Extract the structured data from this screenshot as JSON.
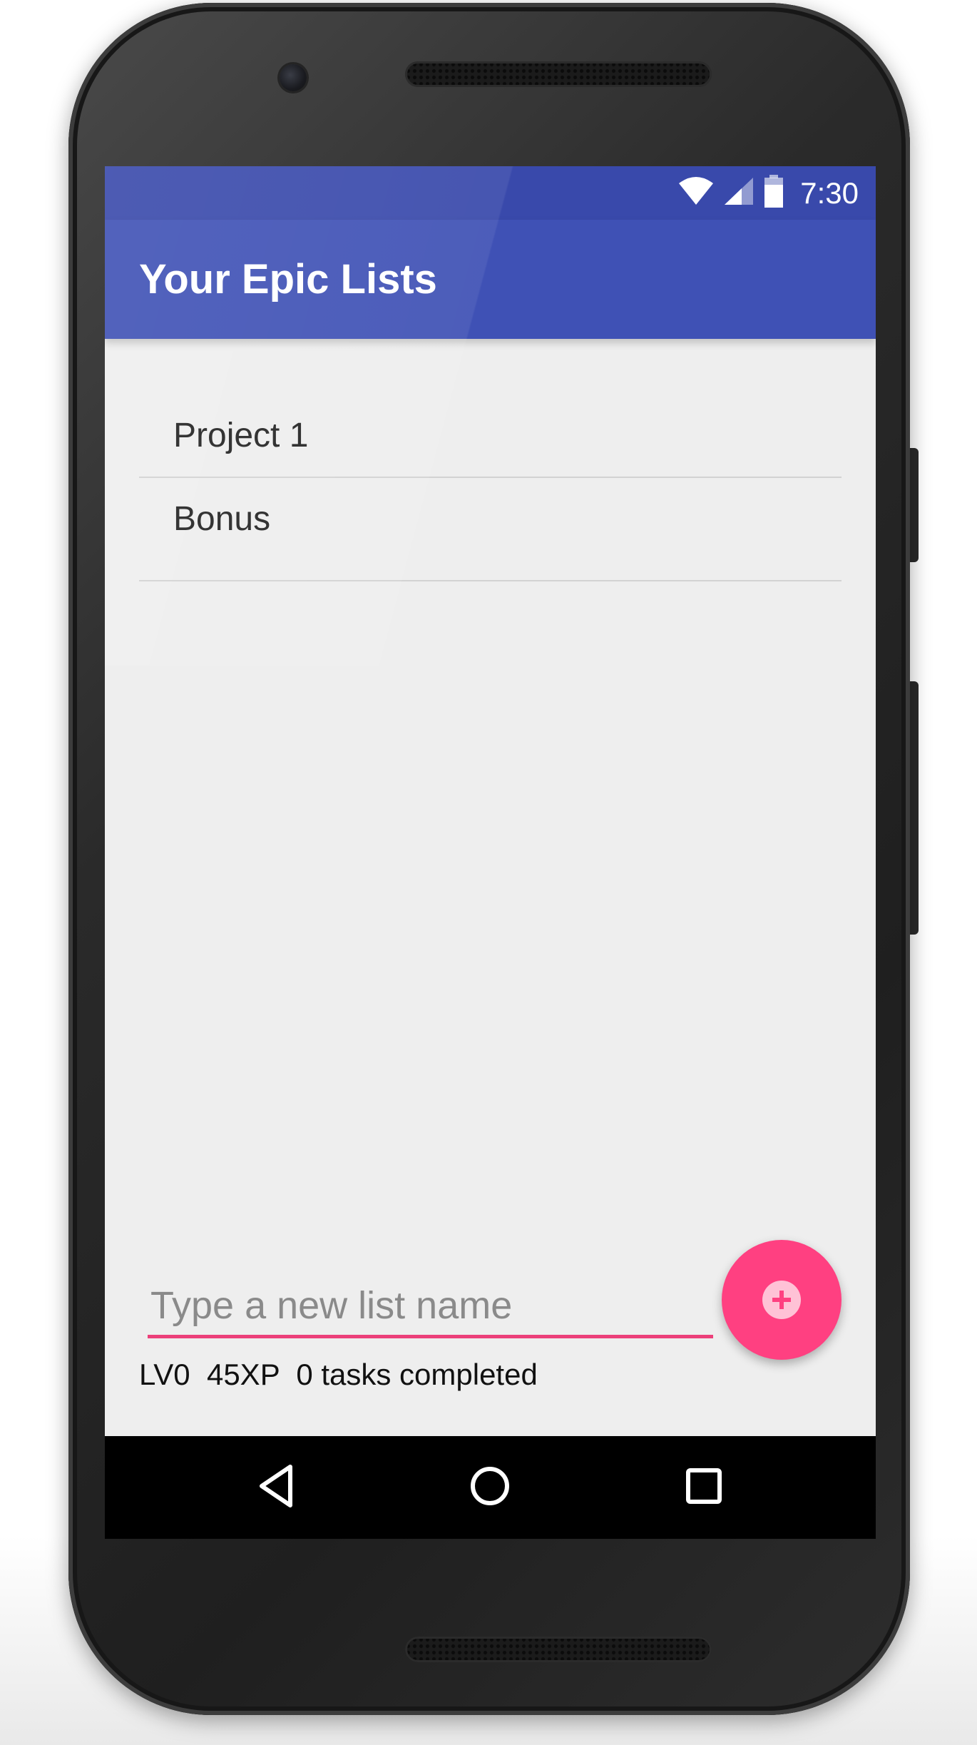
{
  "status_bar": {
    "time": "7:30",
    "icons": [
      "wifi-icon",
      "cell-signal-icon",
      "battery-icon"
    ]
  },
  "app_bar": {
    "title": "Your Epic Lists"
  },
  "lists": {
    "items": [
      {
        "label": "Project 1"
      },
      {
        "label": "Bonus"
      }
    ]
  },
  "new_list": {
    "value": "",
    "placeholder": "Type a new list name",
    "add_icon": "plus-circle-icon"
  },
  "stats": {
    "level": "LV0",
    "xp": "45XP",
    "tasks": "0 tasks completed"
  },
  "nav": {
    "icons": [
      "back-icon",
      "home-icon",
      "recents-icon"
    ]
  },
  "colors": {
    "status_bar": "#3949ab",
    "app_bar": "#3f51b5",
    "accent": "#ff4081",
    "input_underline": "#ec407a",
    "background": "#eeeeee",
    "nav_bar": "#000000"
  }
}
